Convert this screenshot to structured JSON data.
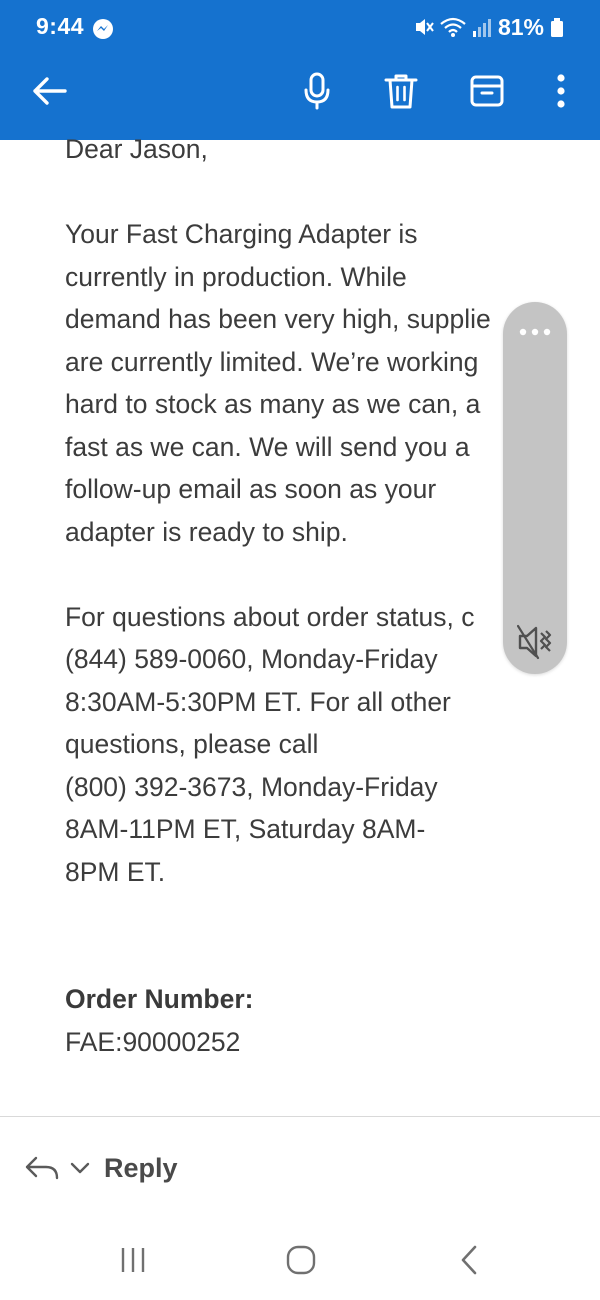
{
  "status_bar": {
    "time": "9:44",
    "battery": "81%"
  },
  "toolbar": {
    "back_icon": "arrow-left-icon",
    "mic_icon": "microphone-icon",
    "delete_icon": "trash-icon",
    "archive_icon": "archive-icon",
    "more_icon": "more-vertical-icon"
  },
  "email": {
    "greeting": "Dear Jason,",
    "paragraph1_lines": [
      "Your Fast Charging Adapter is",
      "currently in production. While",
      "demand has been very high, supplie",
      "are currently limited. We’re working",
      "hard to stock as many as we can, a",
      "fast as we can. We will send you a",
      "follow-up email as soon as your",
      "adapter is ready to ship."
    ],
    "paragraph2_lines": [
      "For questions about order status, c",
      "(844) 589-0060, Monday-Friday",
      "8:30AM-5:30PM ET. For all other",
      "questions, please call",
      "(800) 392-3673, Monday-Friday",
      "8AM-11PM ET, Saturday 8AM-",
      "8PM ET."
    ],
    "order_label": "Order Number:",
    "order_number": "FAE:90000252"
  },
  "reply": {
    "label": "Reply"
  },
  "colors": {
    "header_bg": "#1572cf",
    "panel_bg": "#c4c4c4"
  }
}
